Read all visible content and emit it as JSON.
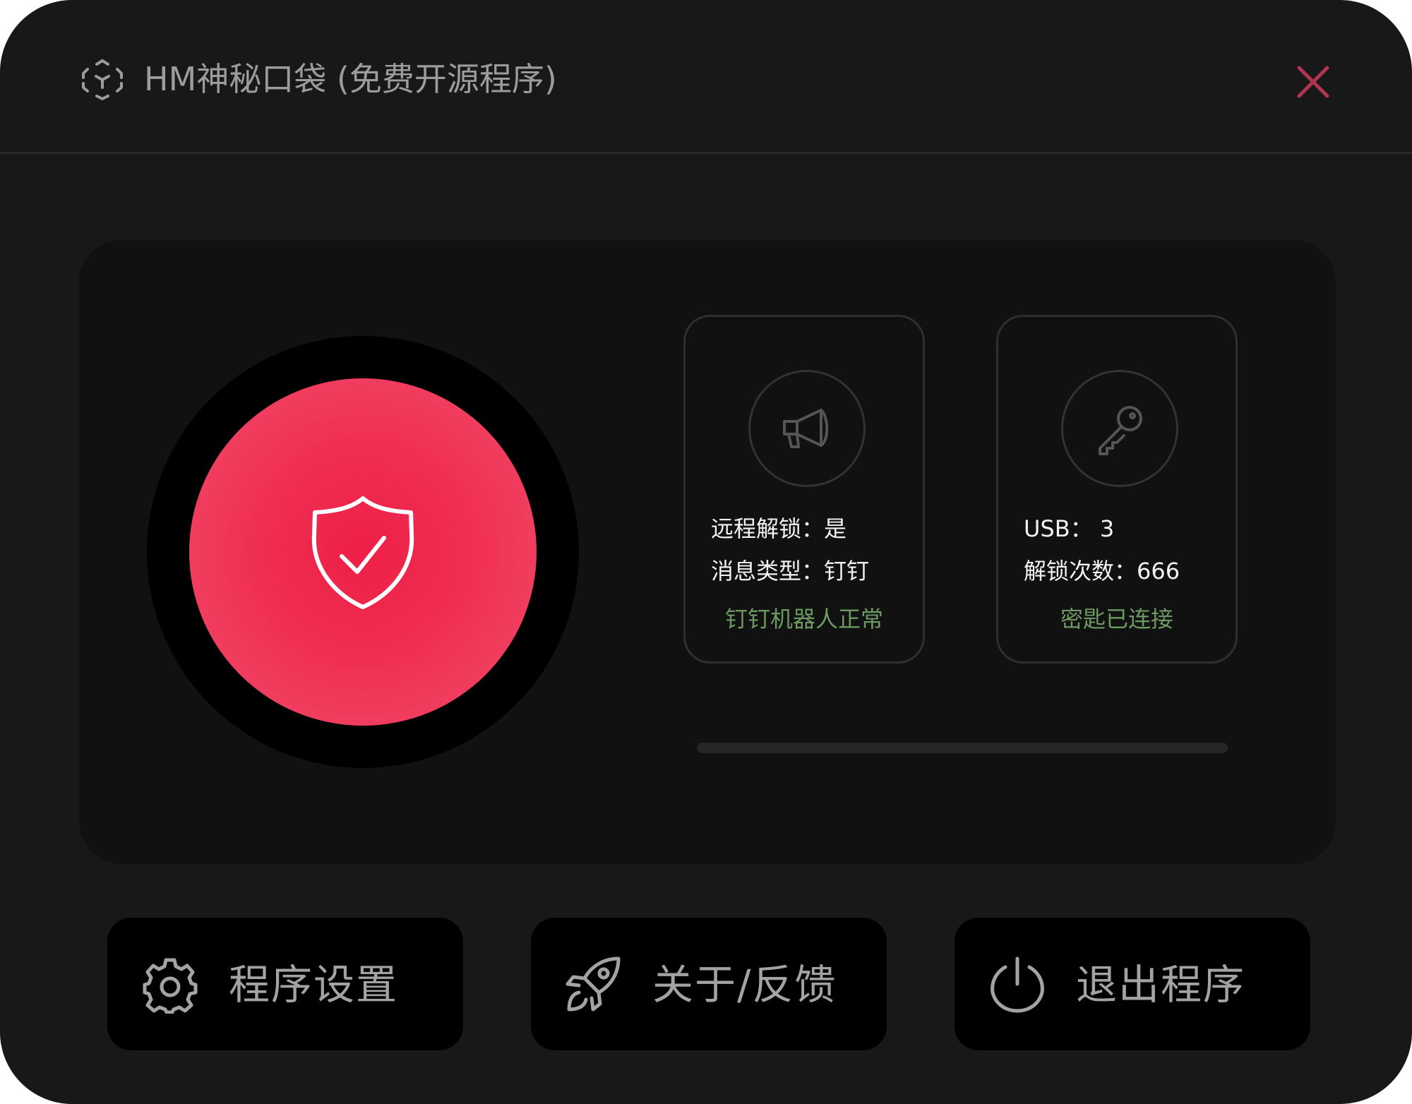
{
  "app": {
    "title": "HM神秘口袋 (免费开源程序)",
    "icon": "scan-face-icon",
    "close_icon": "close-icon"
  },
  "status": {
    "icon": "shield-check-icon",
    "color": "#ee1f47"
  },
  "cards": {
    "notification": {
      "icon": "megaphone-icon",
      "line1": "远程解锁：是",
      "line2": "消息类型：钉钉",
      "status": "钉钉机器人正常"
    },
    "usb": {
      "icon": "key-icon",
      "line1": "USB： 3",
      "line2": "解锁次数：666",
      "status": "密匙已连接"
    }
  },
  "progress": {
    "value": 0
  },
  "actions": {
    "settings": {
      "label": "程序设置",
      "icon": "gear-icon"
    },
    "about": {
      "label": "关于/反馈",
      "icon": "rocket-icon"
    },
    "exit": {
      "label": "退出程序",
      "icon": "power-icon"
    }
  },
  "colors": {
    "background": "#181818",
    "panel": "#111111",
    "accent": "#ee1f47",
    "ok_text": "#6d9a61",
    "close": "#b0344f"
  }
}
